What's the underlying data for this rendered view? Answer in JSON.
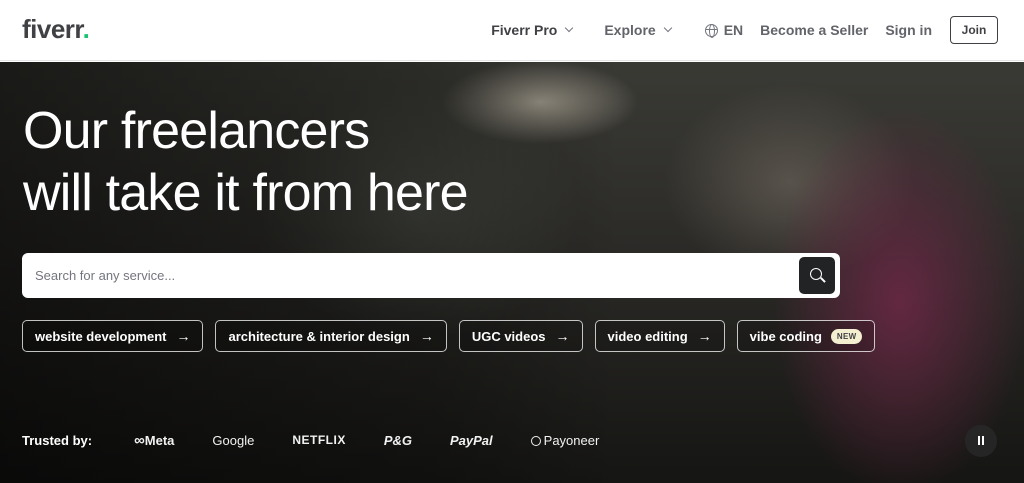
{
  "header": {
    "logo_text": "fiverr",
    "logo_dot": ".",
    "nav": {
      "fiverr_pro": "Fiverr Pro",
      "explore": "Explore",
      "language": "EN",
      "become_seller": "Become a Seller",
      "sign_in": "Sign in",
      "join": "Join"
    }
  },
  "hero": {
    "title_line1": "Our freelancers",
    "title_line2": "will take it from here",
    "search": {
      "placeholder": "Search for any service...",
      "value": ""
    },
    "chips": [
      {
        "label": "website development",
        "arrow": "→"
      },
      {
        "label": "architecture & interior design",
        "arrow": "→"
      },
      {
        "label": "UGC videos",
        "arrow": "→"
      },
      {
        "label": "video editing",
        "arrow": "→"
      },
      {
        "label": "vibe coding",
        "badge": "NEW"
      }
    ],
    "trusted_by": {
      "label": "Trusted by:",
      "brands": [
        "Meta",
        "Google",
        "NETFLIX",
        "P&G",
        "PayPal",
        "Payoneer"
      ]
    }
  },
  "colors": {
    "brand_green": "#1dbf73",
    "text_dark": "#404145",
    "search_button": "#222325",
    "new_badge_bg": "#f4efd0"
  }
}
